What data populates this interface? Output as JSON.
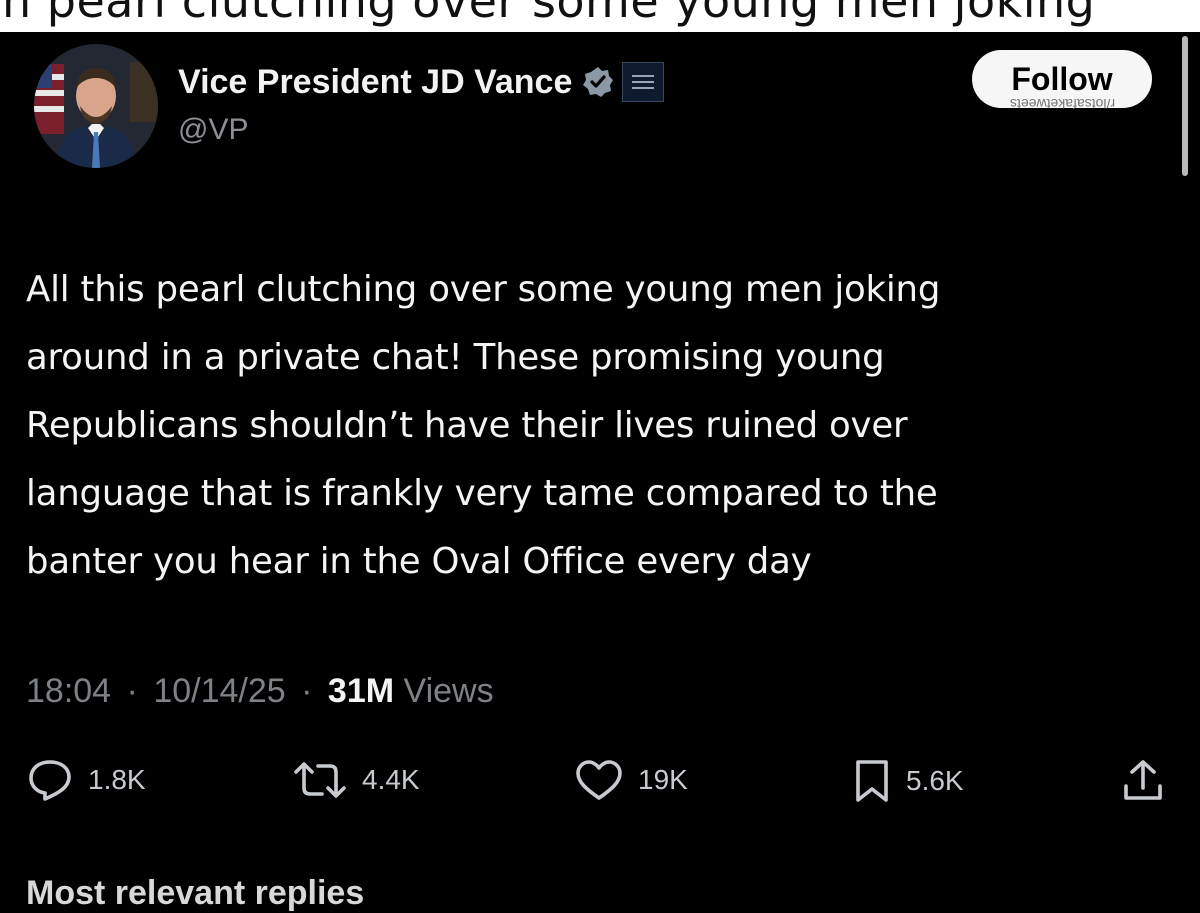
{
  "caption_strip": {
    "text": "n pearl clutching over some young men joking"
  },
  "author": {
    "display_name": "Vice President JD Vance",
    "handle": "@VP"
  },
  "follow_button": {
    "label": "Follow"
  },
  "watermark": {
    "text": "r/lotsafaketweets"
  },
  "tweet": {
    "lines": [
      "All this pearl clutching over some young men joking",
      "around in a private chat! These promising young",
      "Republicans shouldn’t have their lives ruined over",
      "language that is frankly very tame compared to the",
      "banter you hear in the Oval Office every day"
    ]
  },
  "meta": {
    "time": "18:04",
    "date": "10/14/25",
    "views_count": "31M",
    "views_label": "Views",
    "separator": "·"
  },
  "actions": {
    "replies": "1.8K",
    "reposts": "4.4K",
    "likes": "19K",
    "bookmarks": "5.6K"
  },
  "footer": {
    "partial_text": "Most relevant replies"
  },
  "icons": [
    "verified-badge-icon",
    "white-house-seal-icon",
    "reply-icon",
    "repost-icon",
    "like-icon",
    "bookmark-icon",
    "share-icon"
  ],
  "colors": {
    "background": "#000000",
    "text": "#e7e9ea",
    "muted": "#7d8287",
    "follow_bg": "#f6f6f6"
  }
}
